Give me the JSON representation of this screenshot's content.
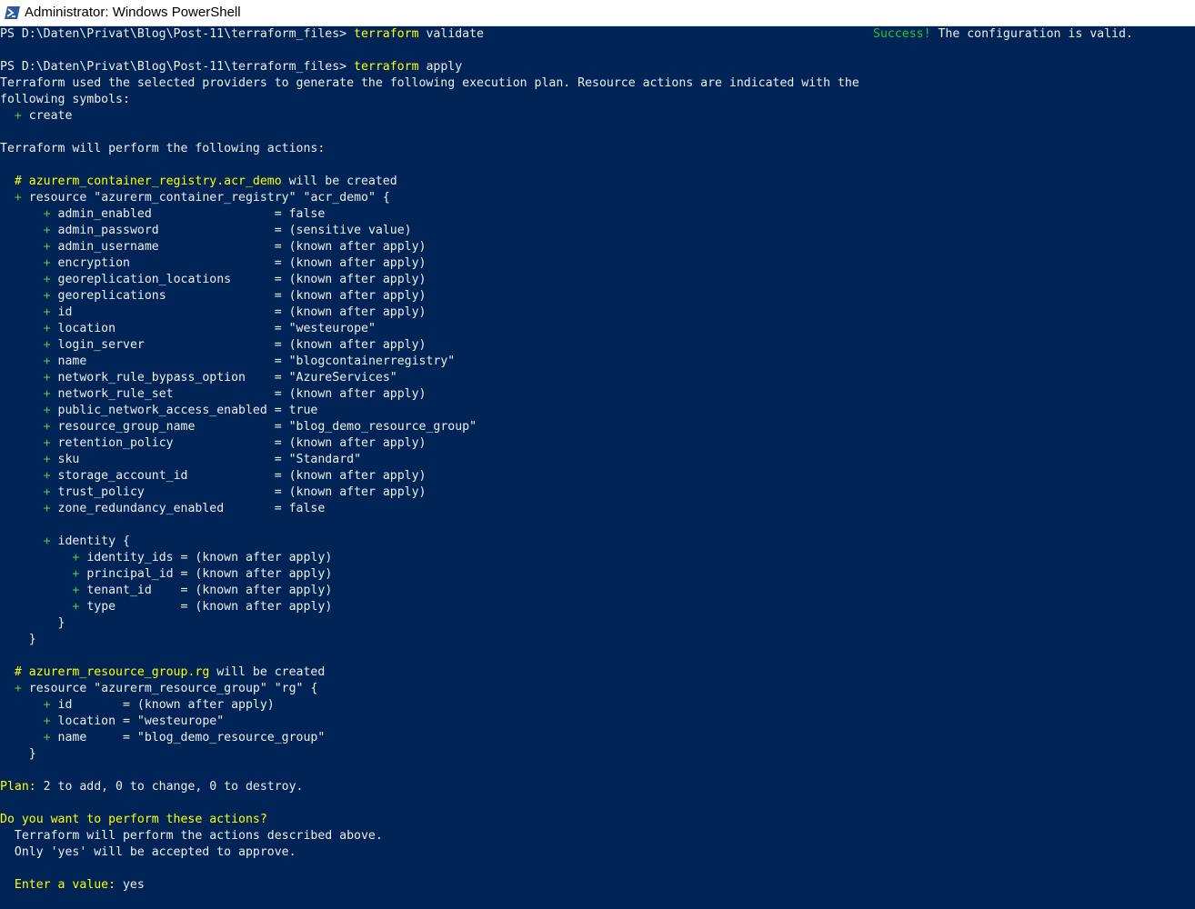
{
  "window": {
    "title": "Administrator: Windows PowerShell"
  },
  "colors": {
    "background": "#012456",
    "foreground": "#eeedf0",
    "yellow": "#ffff00",
    "green": "#4ec94e"
  },
  "terminal": {
    "prompt": "PS D:\\Daten\\Privat\\Blog\\Post-11\\terraform_files> ",
    "cmd1": "terraform",
    "cmd1_arg": " validate",
    "success_label": "Success!",
    "success_msg": " The configuration is valid.",
    "cmd2": "terraform",
    "cmd2_arg": " apply",
    "intro_1": "Terraform used the selected providers to generate the following execution plan. Resource actions are indicated with the",
    "intro_2": "following symbols:",
    "symbol_create": "create",
    "will_perform": "Terraform will perform the following actions:",
    "r1_comment_hash": "  # ",
    "r1_name": "azurerm_container_registry.acr_demo",
    "r1_comment_tail": " will be created",
    "r1_resource_line": "resource \"azurerm_container_registry\" \"acr_demo\" {",
    "r1_attrs": [
      "admin_enabled                 = false",
      "admin_password                = (sensitive value)",
      "admin_username                = (known after apply)",
      "encryption                    = (known after apply)",
      "georeplication_locations      = (known after apply)",
      "georeplications               = (known after apply)",
      "id                            = (known after apply)",
      "location                      = \"westeurope\"",
      "login_server                  = (known after apply)",
      "name                          = \"blogcontainerregistry\"",
      "network_rule_bypass_option    = \"AzureServices\"",
      "network_rule_set              = (known after apply)",
      "public_network_access_enabled = true",
      "resource_group_name           = \"blog_demo_resource_group\"",
      "retention_policy              = (known after apply)",
      "sku                           = \"Standard\"",
      "storage_account_id            = (known after apply)",
      "trust_policy                  = (known after apply)",
      "zone_redundancy_enabled       = false"
    ],
    "identity_open": "identity {",
    "identity_attrs": [
      "identity_ids = (known after apply)",
      "principal_id = (known after apply)",
      "tenant_id    = (known after apply)",
      "type         = (known after apply)"
    ],
    "close_inner": "        }",
    "close_outer": "    }",
    "r2_comment_hash": "  # ",
    "r2_name": "azurerm_resource_group.rg",
    "r2_comment_tail": " will be created",
    "r2_resource_line": "resource \"azurerm_resource_group\" \"rg\" {",
    "r2_attrs": [
      "id       = (known after apply)",
      "location = \"westeurope\"",
      "name     = \"blog_demo_resource_group\""
    ],
    "plan_label": "Plan:",
    "plan_text": " 2 to add, 0 to change, 0 to destroy.",
    "question": "Do you want to perform these actions?",
    "desc_1": "  Terraform will perform the actions described above.",
    "desc_2": "  Only 'yes' will be accepted to approve.",
    "enter_label": "  Enter a value:",
    "enter_value": " yes"
  }
}
